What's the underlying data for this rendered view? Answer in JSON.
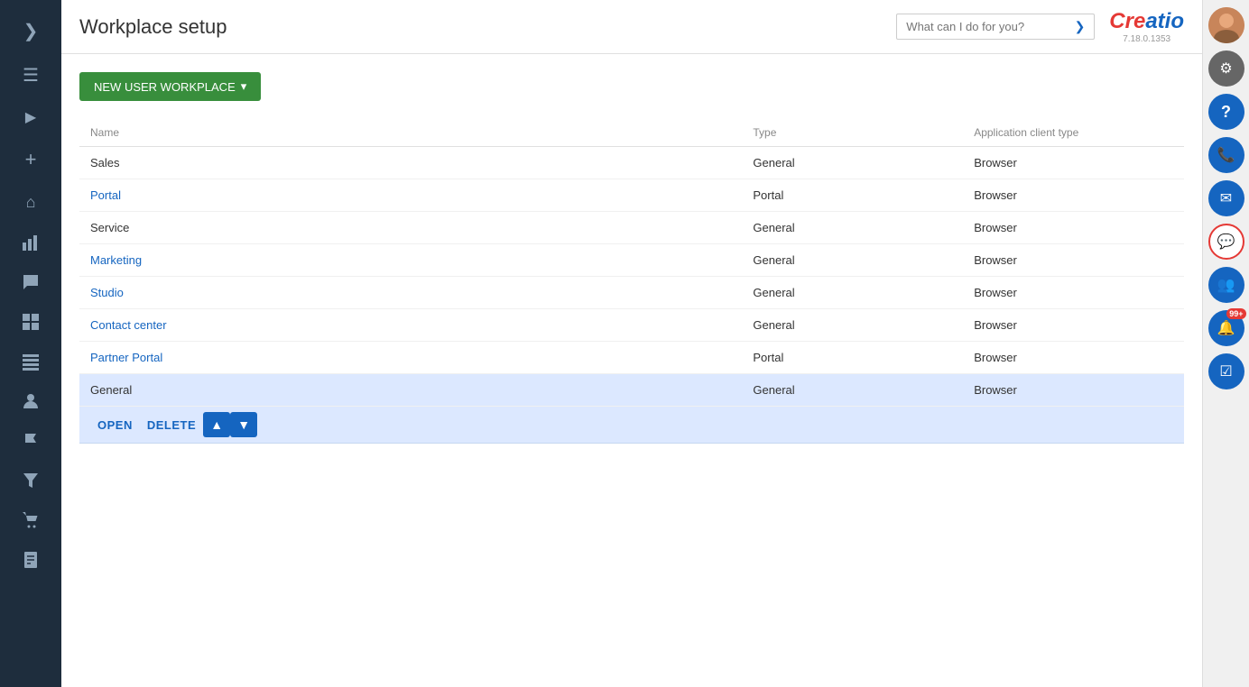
{
  "page": {
    "title": "Workplace setup"
  },
  "header": {
    "search_placeholder": "What can I do for you?",
    "logo": "Creatio",
    "version": "7.18.0.1353"
  },
  "toolbar": {
    "new_button_label": "NEW USER WORKPLACE",
    "new_button_dropdown": "▾"
  },
  "table": {
    "columns": [
      {
        "key": "name",
        "label": "Name"
      },
      {
        "key": "type",
        "label": "Type"
      },
      {
        "key": "app_client_type",
        "label": "Application client type"
      }
    ],
    "rows": [
      {
        "name": "Sales",
        "type": "General",
        "app_client_type": "Browser",
        "is_link": false,
        "selected": false
      },
      {
        "name": "Portal",
        "type": "Portal",
        "app_client_type": "Browser",
        "is_link": true,
        "selected": false
      },
      {
        "name": "Service",
        "type": "General",
        "app_client_type": "Browser",
        "is_link": false,
        "selected": false
      },
      {
        "name": "Marketing",
        "type": "General",
        "app_client_type": "Browser",
        "is_link": true,
        "selected": false
      },
      {
        "name": "Studio",
        "type": "General",
        "app_client_type": "Browser",
        "is_link": true,
        "selected": false
      },
      {
        "name": "Contact center",
        "type": "General",
        "app_client_type": "Browser",
        "is_link": true,
        "selected": false
      },
      {
        "name": "Partner Portal",
        "type": "Portal",
        "app_client_type": "Browser",
        "is_link": true,
        "selected": false
      },
      {
        "name": "General",
        "type": "General",
        "app_client_type": "Browser",
        "is_link": false,
        "selected": true
      }
    ]
  },
  "actions": {
    "open_label": "OPEN",
    "delete_label": "DELETE",
    "up_icon": "▲",
    "down_icon": "▼"
  },
  "sidebar": {
    "items": [
      {
        "id": "chevron-right",
        "icon": "❯",
        "label": "Collapse"
      },
      {
        "id": "hamburger",
        "icon": "☰",
        "label": "Menu"
      },
      {
        "id": "play",
        "icon": "▶",
        "label": "Home"
      },
      {
        "id": "add",
        "icon": "+",
        "label": "Add"
      },
      {
        "id": "home",
        "icon": "⌂",
        "label": "Home page"
      },
      {
        "id": "chart",
        "icon": "📊",
        "label": "Charts"
      },
      {
        "id": "chat",
        "icon": "💬",
        "label": "Chat"
      },
      {
        "id": "grid",
        "icon": "⊞",
        "label": "Grid"
      },
      {
        "id": "list",
        "icon": "☰",
        "label": "List"
      },
      {
        "id": "person",
        "icon": "👤",
        "label": "Person"
      },
      {
        "id": "flag",
        "icon": "⚑",
        "label": "Flag"
      },
      {
        "id": "funnel",
        "icon": "▽",
        "label": "Funnel"
      },
      {
        "id": "cart",
        "icon": "🛒",
        "label": "Cart"
      },
      {
        "id": "note",
        "icon": "📋",
        "label": "Note"
      }
    ]
  },
  "right_sidebar": {
    "items": [
      {
        "id": "avatar",
        "type": "avatar"
      },
      {
        "id": "gear",
        "icon": "⚙",
        "style": "gear"
      },
      {
        "id": "help",
        "icon": "?",
        "style": "help"
      },
      {
        "id": "phone",
        "icon": "📞",
        "style": "phone"
      },
      {
        "id": "email",
        "icon": "✉",
        "style": "email"
      },
      {
        "id": "chat-bubble",
        "icon": "💬",
        "style": "chat"
      },
      {
        "id": "video",
        "icon": "👥",
        "style": "video"
      },
      {
        "id": "notification",
        "icon": "🔔",
        "style": "notification",
        "badge": "99+"
      },
      {
        "id": "tasks",
        "icon": "☑",
        "style": "tasks"
      }
    ]
  }
}
